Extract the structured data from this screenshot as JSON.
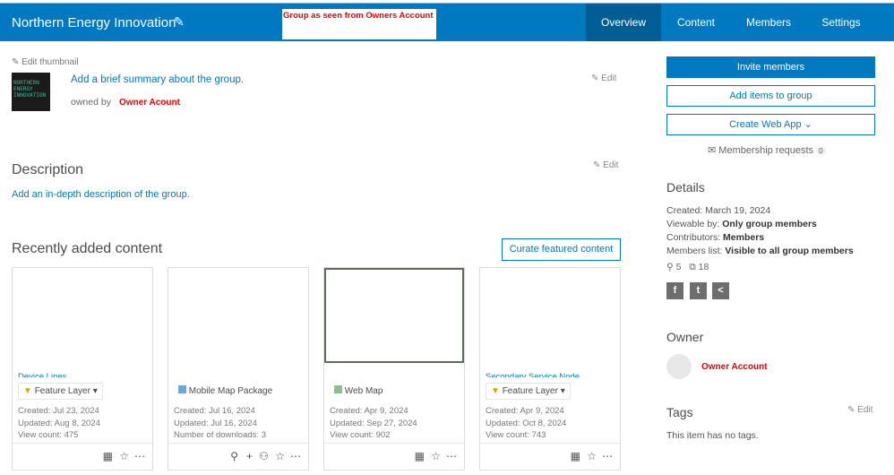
{
  "header": {
    "title": "Northern Energy Innovation",
    "annotation": "Group as seen from Owners Account",
    "tabs": [
      {
        "label": "Overview",
        "active": true
      },
      {
        "label": "Content"
      },
      {
        "label": "Members"
      },
      {
        "label": "Settings"
      }
    ]
  },
  "summary": {
    "edit_thumbnail": "Edit thumbnail",
    "thumbnail_text": "NORTHERN ENERGY INNOVATION",
    "summary_placeholder": "Add a brief summary about the group.",
    "owned_by": "owned by",
    "owner": "Owner Acount",
    "edit": "Edit"
  },
  "description": {
    "heading": "Description",
    "edit": "Edit",
    "placeholder": "Add an in-depth description of the group."
  },
  "recent": {
    "heading": "Recently added content",
    "curate_button": "Curate featured content",
    "cards": [
      {
        "title": "Device Lines",
        "type": "Feature Layer",
        "type_dropdown": true,
        "meta": [
          "Created: Jul 23, 2024",
          "Updated: Aug 8, 2024",
          "View count: 475"
        ]
      },
      {
        "title": "",
        "type": "Mobile Map Package",
        "type_dropdown": false,
        "meta": [
          "Created: Jul 16, 2024",
          "Updated: Jul 16, 2024",
          "Number of downloads: 3"
        ]
      },
      {
        "title": "",
        "type": "Web Map",
        "type_dropdown": false,
        "meta": [
          "Created: Apr 9, 2024",
          "Updated: Sep 27, 2024",
          "View count: 902"
        ]
      },
      {
        "title": "Secondary Service Node",
        "type": "Feature Layer",
        "type_dropdown": true,
        "meta": [
          "Created: Apr 9, 2024",
          "Updated: Oct 8, 2024",
          "View count: 743"
        ]
      }
    ]
  },
  "sidebar": {
    "invite": "Invite members",
    "add_items": "Add items to group",
    "create_app": "Create Web App",
    "membership_requests": "Membership requests",
    "requests_count": "0",
    "details_heading": "Details",
    "details": [
      {
        "label": "Created: ",
        "value": "March 19, 2024"
      },
      {
        "label": "Viewable by: ",
        "value": "Only group members"
      },
      {
        "label": "Contributors: ",
        "value": "Members"
      },
      {
        "label": "Members list: ",
        "value": "Visible to all group members"
      }
    ],
    "member_count": "5",
    "item_count": "18",
    "owner_heading": "Owner",
    "owner_name": "Owner Account",
    "tags_heading": "Tags",
    "tags_edit": "Edit",
    "tags_empty": "This item has no tags."
  },
  "colors": {
    "brand": "#0079c1",
    "annotation": "#e00000"
  }
}
